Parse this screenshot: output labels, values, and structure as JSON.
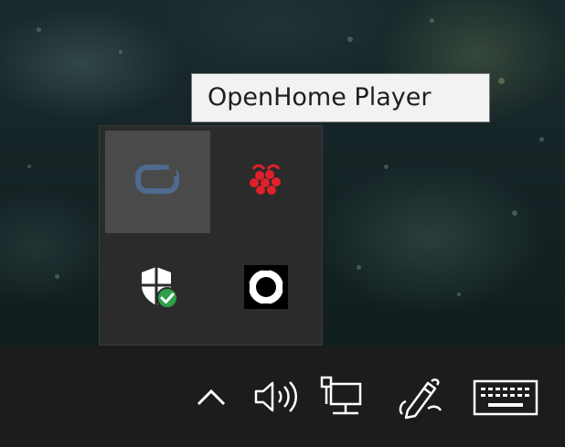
{
  "tooltip": {
    "text": "OpenHome Player"
  },
  "flyout": {
    "icons": [
      {
        "name": "openhome-player-icon",
        "hovered": true
      },
      {
        "name": "raspberry-icon"
      },
      {
        "name": "windows-security-icon"
      },
      {
        "name": "ring-lens-icon"
      }
    ]
  },
  "taskbar": {
    "icons": [
      {
        "name": "chevron-up-icon"
      },
      {
        "name": "speaker-icon"
      },
      {
        "name": "network-icon"
      },
      {
        "name": "pen-icon"
      },
      {
        "name": "keyboard-icon"
      }
    ]
  },
  "colors": {
    "taskbar": "#1c1c1c",
    "flyout": "#2b2b2b",
    "hover": "#4a4a4a",
    "tooltip_bg": "#f2f2f2",
    "security_green": "#2e9e4a",
    "raspberry_red": "#e0202a",
    "openhome_blue": "#4f6a8f"
  }
}
